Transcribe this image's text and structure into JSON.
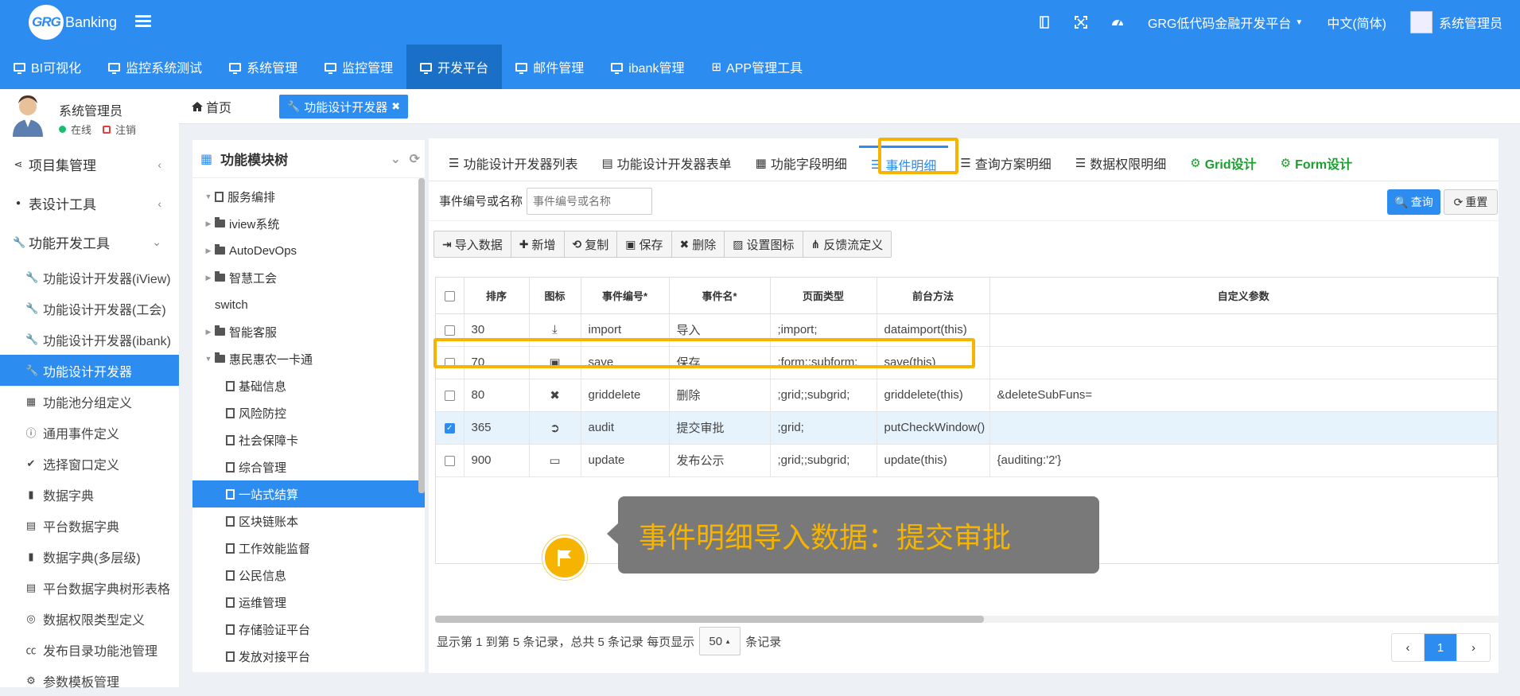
{
  "header": {
    "logo_mark": "GRG",
    "logo_text": "Banking",
    "platform": "GRG低代码金融开发平台",
    "language": "中文(简体)",
    "user": "系统管理员",
    "icons": [
      "book-icon",
      "fullscreen-icon",
      "dashboard-icon"
    ]
  },
  "nav": [
    {
      "label": "BI可视化",
      "active": false
    },
    {
      "label": "监控系统测试",
      "active": false
    },
    {
      "label": "系统管理",
      "active": false
    },
    {
      "label": "监控管理",
      "active": false
    },
    {
      "label": "开发平台",
      "active": true
    },
    {
      "label": "邮件管理",
      "active": false
    },
    {
      "label": "ibank管理",
      "active": false
    },
    {
      "label": "APP管理工具",
      "active": false
    }
  ],
  "sidebar": {
    "user_name": "系统管理员",
    "status_online": "在线",
    "status_logout": "注销",
    "groups": [
      {
        "label": "项目集管理",
        "chev": "‹"
      },
      {
        "label": "表设计工具",
        "chev": "‹"
      },
      {
        "label": "功能开发工具",
        "chev": "⌄"
      }
    ],
    "items": [
      {
        "label": "功能设计开发器(iView)",
        "icon": "wrench-icon",
        "glyph": "🔧",
        "active": false
      },
      {
        "label": "功能设计开发器(工会)",
        "icon": "wrench-icon",
        "glyph": "🔧",
        "active": false
      },
      {
        "label": "功能设计开发器(ibank)",
        "icon": "wrench-icon",
        "glyph": "🔧",
        "active": false
      },
      {
        "label": "功能设计开发器",
        "icon": "wrench-icon",
        "glyph": "🔧",
        "active": true
      },
      {
        "label": "功能池分组定义",
        "icon": "grid-icon",
        "glyph": "▦",
        "active": false
      },
      {
        "label": "通用事件定义",
        "icon": "info-icon",
        "glyph": "ⓘ",
        "active": false
      },
      {
        "label": "选择窗口定义",
        "icon": "check-circle-icon",
        "glyph": "✔",
        "active": false
      },
      {
        "label": "数据字典",
        "icon": "book-icon",
        "glyph": "▮",
        "active": false
      },
      {
        "label": "平台数据字典",
        "icon": "table-icon",
        "glyph": "▤",
        "active": false
      },
      {
        "label": "数据字典(多层级)",
        "icon": "book-icon",
        "glyph": "▮",
        "active": false
      },
      {
        "label": "平台数据字典树形表格",
        "icon": "table-icon",
        "glyph": "▤",
        "active": false
      },
      {
        "label": "数据权限类型定义",
        "icon": "target-icon",
        "glyph": "◎",
        "active": false
      },
      {
        "label": "发布目录功能池管理",
        "icon": "cc-icon",
        "glyph": "㏄",
        "active": false
      },
      {
        "label": "参数模板管理",
        "icon": "gear-icon",
        "glyph": "⚙",
        "active": false
      }
    ]
  },
  "breadcrumb": {
    "home": "首页",
    "current_tab": "功能设计开发器"
  },
  "tree": {
    "title": "功能模块树",
    "nodes": [
      {
        "label": "服务编排",
        "indent": 0,
        "type": "doc",
        "toggle": "▼",
        "selected": false
      },
      {
        "label": "iview系统",
        "indent": 0,
        "type": "folder",
        "toggle": "▶",
        "selected": false
      },
      {
        "label": "AutoDevOps",
        "indent": 0,
        "type": "folder",
        "toggle": "▶",
        "selected": false
      },
      {
        "label": "智慧工会",
        "indent": 0,
        "type": "folder",
        "toggle": "▶",
        "selected": false
      },
      {
        "label": "switch",
        "indent": 0,
        "type": "none",
        "toggle": "",
        "selected": false
      },
      {
        "label": "智能客服",
        "indent": 0,
        "type": "folder",
        "toggle": "▶",
        "selected": false
      },
      {
        "label": "惠民惠农一卡通",
        "indent": 0,
        "type": "open",
        "toggle": "▼",
        "selected": false
      },
      {
        "label": "基础信息",
        "indent": 1,
        "type": "doc",
        "toggle": "",
        "selected": false
      },
      {
        "label": "风险防控",
        "indent": 1,
        "type": "doc",
        "toggle": "",
        "selected": false
      },
      {
        "label": "社会保障卡",
        "indent": 1,
        "type": "doc",
        "toggle": "",
        "selected": false
      },
      {
        "label": "综合管理",
        "indent": 1,
        "type": "doc",
        "toggle": "",
        "selected": false
      },
      {
        "label": "一站式结算",
        "indent": 1,
        "type": "doc",
        "toggle": "",
        "selected": true
      },
      {
        "label": "区块链账本",
        "indent": 1,
        "type": "doc",
        "toggle": "",
        "selected": false
      },
      {
        "label": "工作效能监督",
        "indent": 1,
        "type": "doc",
        "toggle": "",
        "selected": false
      },
      {
        "label": "公民信息",
        "indent": 1,
        "type": "doc",
        "toggle": "",
        "selected": false
      },
      {
        "label": "运维管理",
        "indent": 1,
        "type": "doc",
        "toggle": "",
        "selected": false
      },
      {
        "label": "存储验证平台",
        "indent": 1,
        "type": "doc",
        "toggle": "",
        "selected": false
      },
      {
        "label": "发放对接平台",
        "indent": 1,
        "type": "doc",
        "toggle": "",
        "selected": false
      }
    ]
  },
  "tabs": [
    {
      "label": "功能设计开发器列表",
      "glyph": "☰",
      "icon": "list-icon",
      "active": false,
      "green": false
    },
    {
      "label": "功能设计开发器表单",
      "glyph": "▤",
      "icon": "form-icon",
      "active": false,
      "green": false
    },
    {
      "label": "功能字段明细",
      "glyph": "▦",
      "icon": "table-icon",
      "active": false,
      "green": false
    },
    {
      "label": "事件明细",
      "glyph": "☰",
      "icon": "list-icon",
      "active": true,
      "green": false
    },
    {
      "label": "查询方案明细",
      "glyph": "☰",
      "icon": "list-icon",
      "active": false,
      "green": false
    },
    {
      "label": "数据权限明细",
      "glyph": "☰",
      "icon": "list-icon",
      "active": false,
      "green": false
    },
    {
      "label": "Grid设计",
      "glyph": "⚙",
      "icon": "gear-icon",
      "active": false,
      "green": true
    },
    {
      "label": "Form设计",
      "glyph": "⚙",
      "icon": "gear-icon",
      "active": false,
      "green": true
    }
  ],
  "search": {
    "label": "事件编号或名称",
    "placeholder": "事件编号或名称",
    "query_btn": "查询",
    "reset_btn": "重置"
  },
  "toolbar": [
    {
      "label": "导入数据",
      "glyph": "⇥",
      "icon": "import-icon"
    },
    {
      "label": "新增",
      "glyph": "✚",
      "icon": "plus-icon"
    },
    {
      "label": "复制",
      "glyph": "⟲",
      "icon": "copy-icon"
    },
    {
      "label": "保存",
      "glyph": "▣",
      "icon": "save-icon"
    },
    {
      "label": "删除",
      "glyph": "✖",
      "icon": "delete-icon"
    },
    {
      "label": "设置图标",
      "glyph": "▨",
      "icon": "image-icon"
    },
    {
      "label": "反馈流定义",
      "glyph": "⋔",
      "icon": "sitemap-icon"
    }
  ],
  "grid": {
    "columns": [
      "排序",
      "图标",
      "事件编号*",
      "事件名*",
      "页面类型",
      "前台方法",
      "自定义参数"
    ],
    "rows": [
      {
        "checked": false,
        "order": "30",
        "icon": "download-icon",
        "glyph": "⤓",
        "code": "import",
        "name": "导入",
        "page_type": ";import;",
        "method": "dataimport(this)",
        "params": ""
      },
      {
        "checked": false,
        "order": "70",
        "icon": "save-icon",
        "glyph": "▣",
        "code": "save",
        "name": "保存",
        "page_type": ";form;;subform;",
        "method": "save(this)",
        "params": ""
      },
      {
        "checked": false,
        "order": "80",
        "icon": "close-icon",
        "glyph": "✖",
        "code": "griddelete",
        "name": "删除",
        "page_type": ";grid;;subgrid;",
        "method": "griddelete(this)",
        "params": "&deleteSubFuns="
      },
      {
        "checked": true,
        "order": "365",
        "icon": "arrow-circle-icon",
        "glyph": "➲",
        "code": "audit",
        "name": "提交审批",
        "page_type": ";grid;",
        "method": "putCheckWindow()",
        "params": ""
      },
      {
        "checked": false,
        "order": "900",
        "icon": "calendar-icon",
        "glyph": "▭",
        "code": "update",
        "name": "发布公示",
        "page_type": ";grid;;subgrid;",
        "method": "update(this)",
        "params": "{auditing:'2'}"
      }
    ]
  },
  "footer": {
    "summary": "显示第 1 到第 5 条记录，总共 5 条记录 每页显示",
    "page_size": "50",
    "suffix": "条记录",
    "prev": "‹",
    "page": "1",
    "next": "›"
  },
  "callout": {
    "text": "事件明细导入数据：提交审批"
  },
  "colors": {
    "primary": "#2d8cf0",
    "highlight": "#f6b400",
    "green": "#1a9f2e"
  }
}
